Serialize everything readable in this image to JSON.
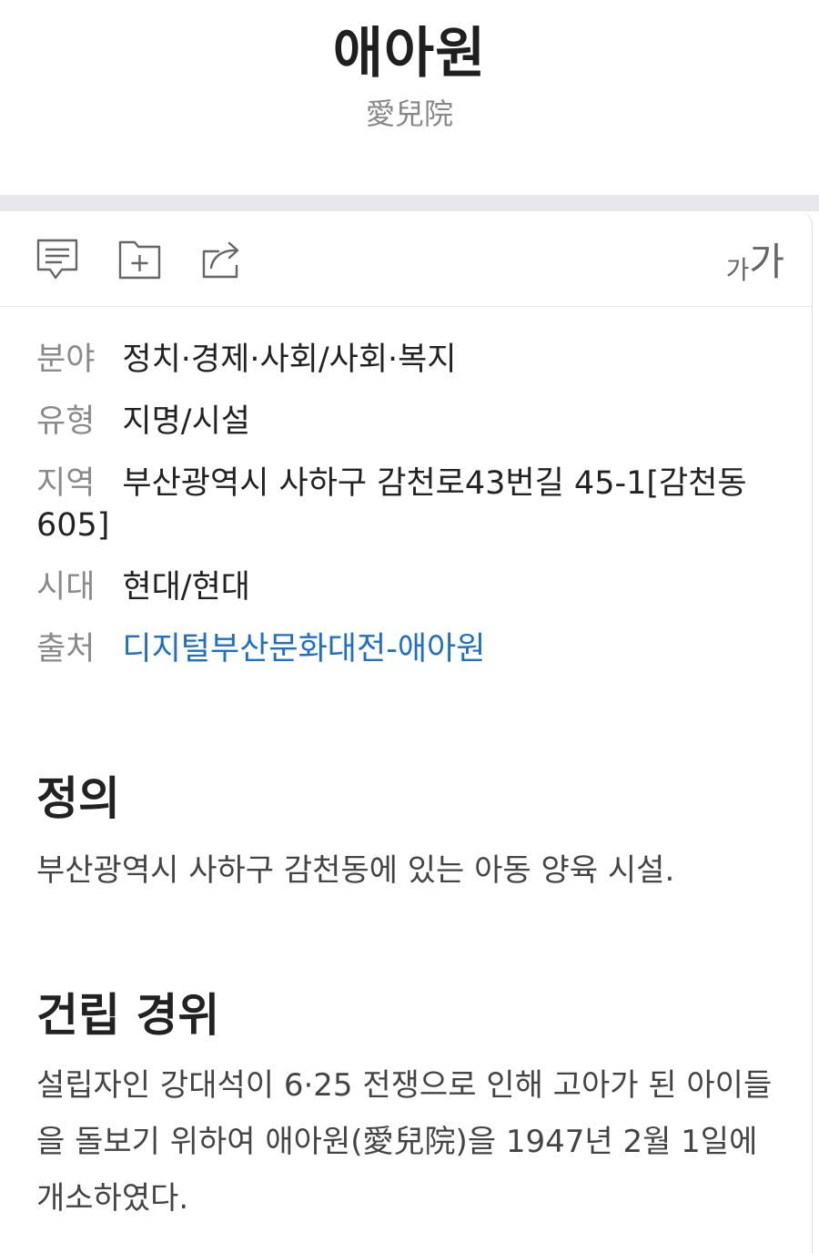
{
  "header": {
    "title": "애아원",
    "hanja": "愛兒院"
  },
  "toolbar": {
    "icons": [
      "comment-icon",
      "add-folder-icon",
      "share-icon"
    ],
    "font_small": "가",
    "font_big": "가"
  },
  "info": {
    "field_label": "분야",
    "field_value": "정치·경제·사회/사회·복지",
    "type_label": "유형",
    "type_value": "지명/시설",
    "region_label": "지역",
    "region_value": "부산광역시 사하구 감천로43번길 45-1[감천동 605]",
    "era_label": "시대",
    "era_value": "현대/현대",
    "source_label": "출처",
    "source_value": "디지털부산문화대전-애아원"
  },
  "definition": {
    "title": "정의",
    "text": "부산광역시 사하구 감천동에 있는 아동 양육 시설."
  },
  "history": {
    "title": "건립 경위",
    "text": "설립자인 강대석이 6·25 전쟁으로 인해 고아가 된 아이들을 돌보기 위하여 애아원(愛兒院)을 1947년 2월 1일에 개소하였다."
  },
  "colors": {
    "link": "#1f6fc2",
    "label": "#8a8a8a",
    "band": "#e8e8ec"
  }
}
